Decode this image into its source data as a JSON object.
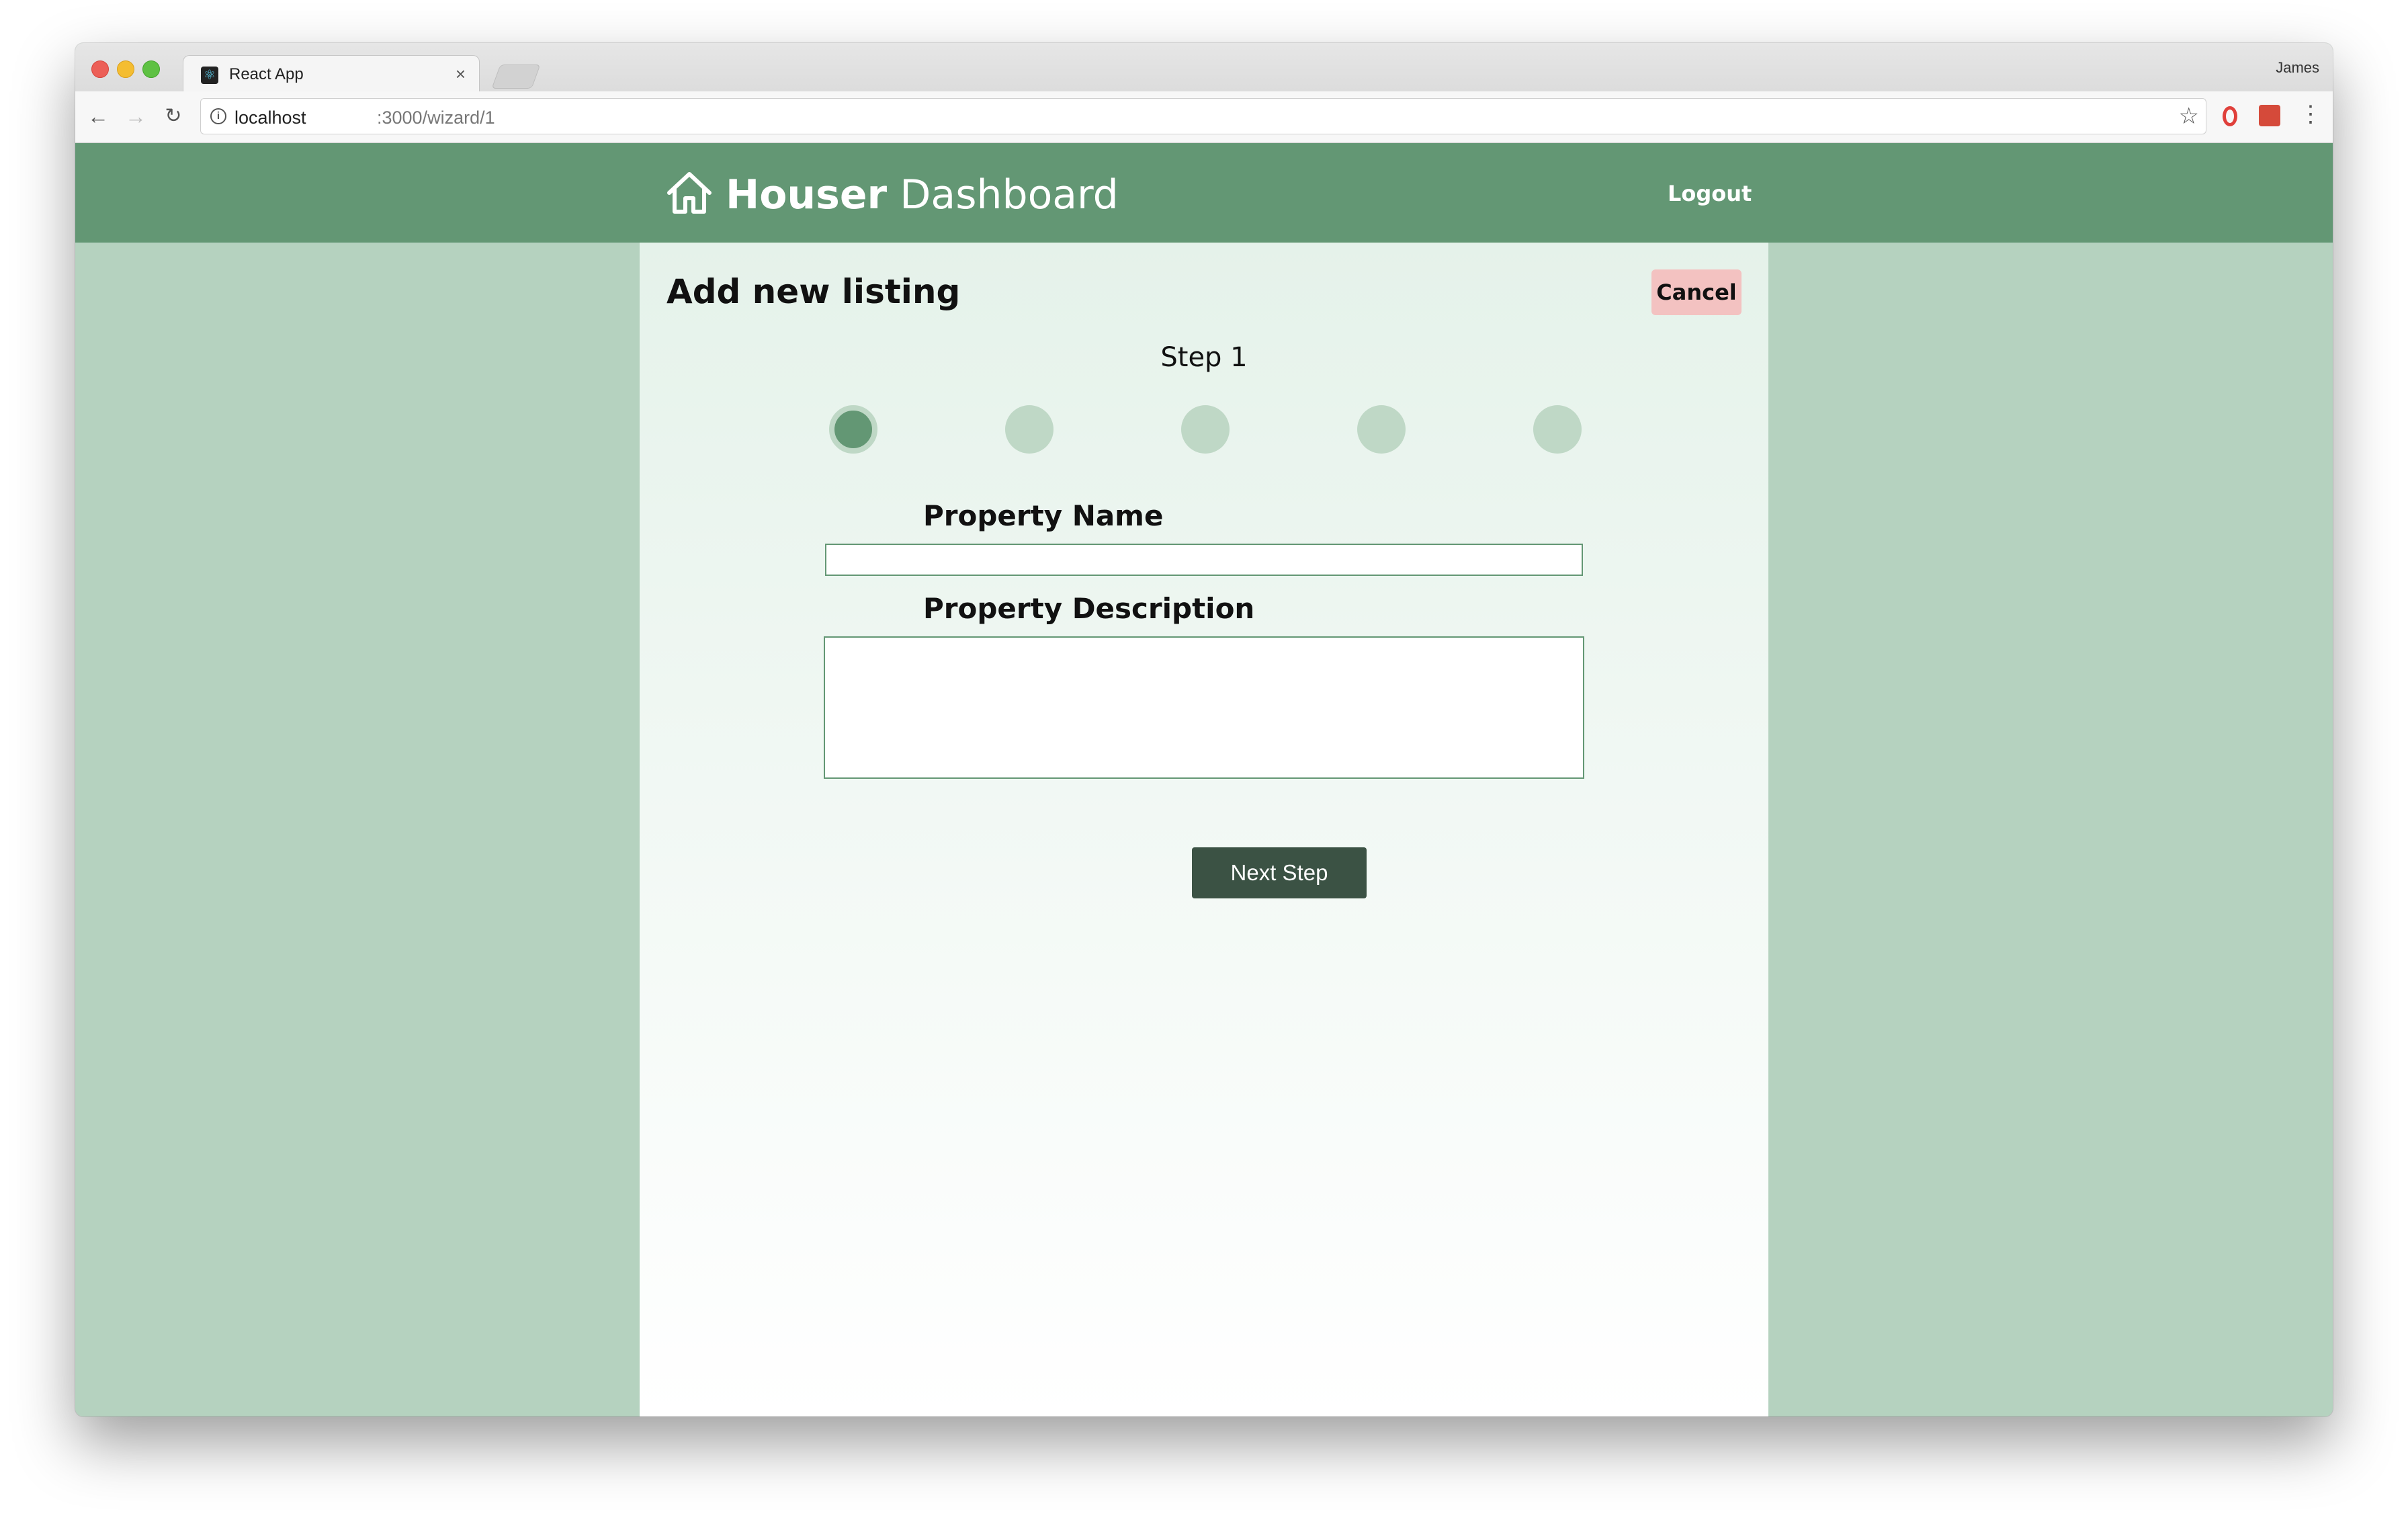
{
  "browser": {
    "tab_title": "React App",
    "tab_close": "×",
    "profile_name": "James",
    "url_host": "localhost",
    "url_path": ":3000/wizard/1",
    "icons": {
      "back": "arrow-left-icon",
      "forward": "arrow-right-icon",
      "reload": "reload-icon",
      "info": "info-icon",
      "bookmark": "star-icon",
      "menu": "menu-dots-icon"
    }
  },
  "header": {
    "brand_bold": "Houser",
    "brand_light": "Dashboard",
    "logout_label": "Logout"
  },
  "wizard": {
    "title": "Add new listing",
    "cancel_label": "Cancel",
    "step_label": "Step 1",
    "steps_total": 5,
    "current_step": 1,
    "property_name_label": "Property Name",
    "property_name_value": "",
    "property_description_label": "Property Description",
    "property_description_value": "",
    "next_label": "Next Step"
  },
  "colors": {
    "header_bg": "#639774",
    "page_bg": "#b5d2bf",
    "step_active": "#639774",
    "step_inactive": "#bfd8c6",
    "cancel_bg": "#f3c2c1",
    "next_bg": "#3b5244"
  }
}
